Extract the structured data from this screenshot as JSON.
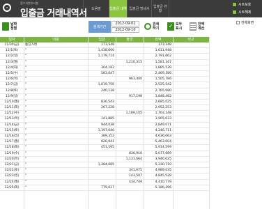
{
  "header": {
    "brand_sub": "협우지원부서별",
    "title": "입출금 거래내역서",
    "nav": [
      {
        "label": "도움말"
      },
      {
        "label": "입출금\n내역"
      },
      {
        "label": "입출금\n명세서"
      },
      {
        "label": "입출금\n현황"
      }
    ],
    "sheet_protect": "시트보호",
    "sheet_unprotect": "시트해제"
  },
  "toolbar": {
    "date_button": "날짜\n정렬",
    "period_label": "검색기간",
    "date_from": "2012-09-01",
    "date_to": "2012-09-10",
    "search_button": "검색\n하기",
    "show_all_button": "모두\n표시",
    "balance_button": "잔액\n계산",
    "fullscreen_label": "전체화면"
  },
  "table": {
    "columns": [
      "일자",
      "내용",
      "입금",
      "출금",
      "잔액",
      "비고"
    ],
    "rows": [
      {
        "date": "11/30(금)",
        "desc": "통장거래",
        "deposit": "173,348",
        "withdraw": "",
        "balance": "173,348"
      },
      {
        "date": "12/1(토)",
        "desc": "\"",
        "deposit": "1,438,600",
        "withdraw": "",
        "balance": "1,611,948"
      },
      {
        "date": "12/2(일)",
        "desc": "\"",
        "deposit": "1,179,714",
        "withdraw": "",
        "balance": "2,791,662"
      },
      {
        "date": "12/3(월)",
        "desc": "\"",
        "deposit": "",
        "withdraw": "1,210,315",
        "balance": "1,581,347"
      },
      {
        "date": "12/4(화)",
        "desc": "\"",
        "deposit": "304,192",
        "withdraw": "",
        "balance": "1,885,539"
      },
      {
        "date": "12/5(수)",
        "desc": "\"",
        "deposit": "583,647",
        "withdraw": "",
        "balance": "2,469,186"
      },
      {
        "date": "12/6(목)",
        "desc": "\"",
        "deposit": "",
        "withdraw": "963,400",
        "balance": "1,505,786"
      },
      {
        "date": "12/7(금)",
        "desc": "\"",
        "deposit": "1,019,756",
        "withdraw": "",
        "balance": "2,525,542"
      },
      {
        "date": "12/8(토)",
        "desc": "\"",
        "deposit": "240,138",
        "withdraw": "",
        "balance": "2,765,680"
      },
      {
        "date": "12/9(일)",
        "desc": "\"",
        "deposit": "",
        "withdraw": "917,198",
        "balance": "1,848,482"
      },
      {
        "date": "12/10(월)",
        "desc": "\"",
        "deposit": "836,543",
        "withdraw": "",
        "balance": "2,685,025"
      },
      {
        "date": "12/11(화)",
        "desc": "\"",
        "deposit": "267,228",
        "withdraw": "",
        "balance": "2,952,253"
      },
      {
        "date": "12/12(수)",
        "desc": "\"",
        "deposit": "",
        "withdraw": "1,189,105",
        "balance": "1,763,148"
      },
      {
        "date": "12/13(목)",
        "desc": "\"",
        "deposit": "141,885",
        "withdraw": "",
        "balance": "1,905,033"
      },
      {
        "date": "12/14(금)",
        "desc": "\"",
        "deposit": "944,038",
        "withdraw": "",
        "balance": "2,849,071"
      },
      {
        "date": "12/15(토)",
        "desc": "\"",
        "deposit": "1,397,640",
        "withdraw": "",
        "balance": "4,246,711"
      },
      {
        "date": "12/16(일)",
        "desc": "\"",
        "deposit": "389,352",
        "withdraw": "",
        "balance": "4,636,063"
      },
      {
        "date": "12/17(월)",
        "desc": "\"",
        "deposit": "826,941",
        "withdraw": "",
        "balance": "5,463,004"
      },
      {
        "date": "12/18(화)",
        "desc": "\"",
        "deposit": "451,595",
        "withdraw": "",
        "balance": "5,914,599"
      },
      {
        "date": "12/19(수)",
        "desc": "\"",
        "deposit": "",
        "withdraw": "836,910",
        "balance": "5,077,689"
      },
      {
        "date": "12/20(목)",
        "desc": "\"",
        "deposit": "",
        "withdraw": "1,131,664",
        "balance": "3,946,025"
      },
      {
        "date": "12/21(금)",
        "desc": "\"",
        "deposit": "1,384,685",
        "withdraw": "",
        "balance": "5,330,710"
      },
      {
        "date": "12/22(토)",
        "desc": "\"",
        "deposit": "",
        "withdraw": "341,675",
        "balance": "4,989,035"
      },
      {
        "date": "12/23(일)",
        "desc": "\"",
        "deposit": "",
        "withdraw": "143,507",
        "balance": "4,845,528"
      },
      {
        "date": "12/24(월)",
        "desc": "\"",
        "deposit": "",
        "withdraw": "434,749",
        "balance": "4,410,779"
      },
      {
        "date": "12/25(화)",
        "desc": "\"",
        "deposit": "775,617",
        "withdraw": "",
        "balance": "5,186,396"
      }
    ]
  }
}
